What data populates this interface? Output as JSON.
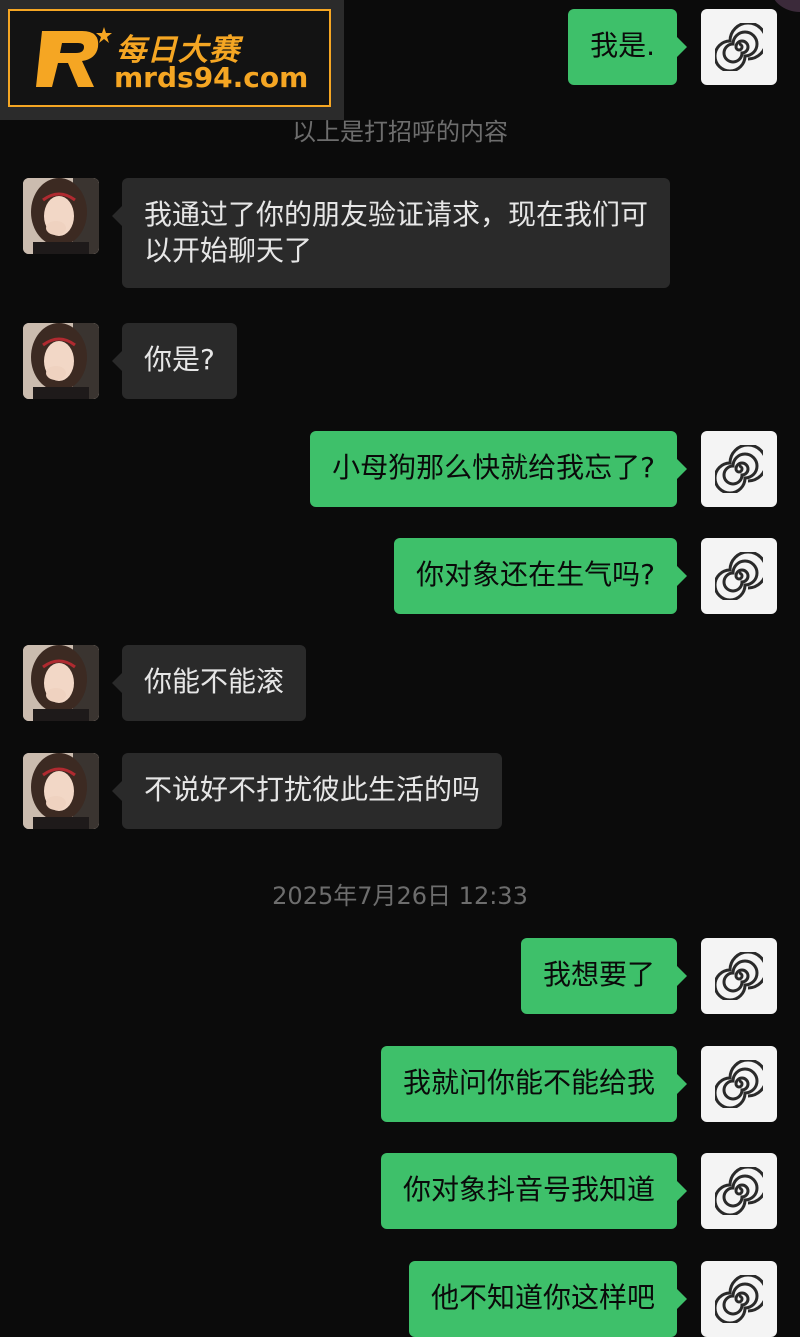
{
  "watermark": {
    "brand": "每日大赛",
    "url": "mrds94.com",
    "accent": "#f5a623"
  },
  "notices": {
    "greeting": "以上是打招呼的内容",
    "timestamp": "2025年7月26日 12:33"
  },
  "colors": {
    "background": "#0b0b0b",
    "outgoing_bubble": "#3ec06a",
    "incoming_bubble": "#2a2a2a"
  },
  "messages": [
    {
      "side": "out",
      "avatar": "spiral-avatar",
      "text": "我是."
    },
    {
      "side": "in",
      "avatar": "girl-photo-avatar",
      "text": "我通过了你的朋友验证请求，现在我们可以开始聊天了"
    },
    {
      "side": "in",
      "avatar": "girl-photo-avatar",
      "text": "你是?"
    },
    {
      "side": "out",
      "avatar": "spiral-avatar",
      "text": "小母狗那么快就给我忘了?"
    },
    {
      "side": "out",
      "avatar": "spiral-avatar",
      "text": "你对象还在生气吗?"
    },
    {
      "side": "in",
      "avatar": "girl-photo-avatar",
      "text": "你能不能滚"
    },
    {
      "side": "in",
      "avatar": "girl-photo-avatar",
      "text": "不说好不打扰彼此生活的吗"
    },
    {
      "side": "out",
      "avatar": "spiral-avatar",
      "text": "我想要了"
    },
    {
      "side": "out",
      "avatar": "spiral-avatar",
      "text": "我就问你能不能给我"
    },
    {
      "side": "out",
      "avatar": "spiral-avatar",
      "text": "你对象抖音号我知道"
    },
    {
      "side": "out",
      "avatar": "spiral-avatar",
      "text": "他不知道你这样吧"
    }
  ]
}
